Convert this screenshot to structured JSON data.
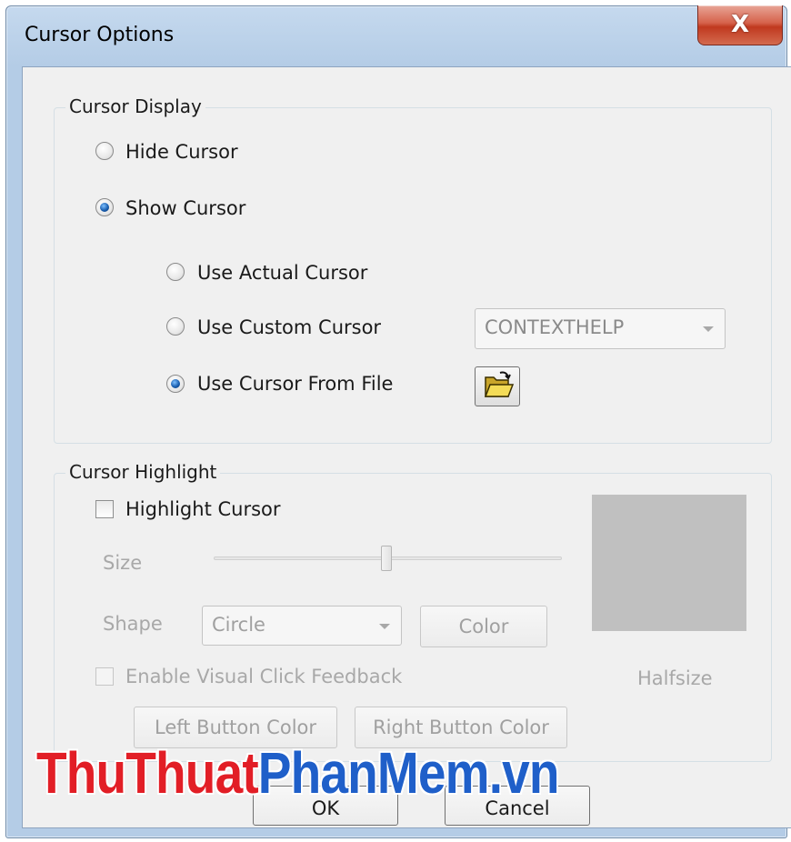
{
  "window": {
    "title": "Cursor Options",
    "close_glyph": "X"
  },
  "cursor_display": {
    "group_title": "Cursor Display",
    "hide_cursor": {
      "label": "Hide Cursor",
      "checked": false
    },
    "show_cursor": {
      "label": "Show Cursor",
      "checked": true
    },
    "use_actual_cursor": {
      "label": "Use Actual Cursor",
      "checked": false
    },
    "use_custom_cursor": {
      "label": "Use Custom Cursor",
      "checked": false
    },
    "custom_cursor_select": {
      "value": "CONTEXTHELP"
    },
    "use_cursor_from_file": {
      "label": "Use Cursor From File",
      "checked": true
    },
    "browse_icon": "open-folder-icon"
  },
  "cursor_highlight": {
    "group_title": "Cursor Highlight",
    "highlight_cursor": {
      "label": "Highlight Cursor",
      "checked": false
    },
    "size_label": "Size",
    "size_slider_value": 0.5,
    "shape_label": "Shape",
    "shape_select": {
      "value": "Circle"
    },
    "color_button": "Color",
    "enable_visual_click": {
      "label": "Enable Visual Click Feedback",
      "checked": false
    },
    "preview_caption": "Halfsize",
    "left_button_color": "Left Button Color",
    "right_button_color": "Right Button Color"
  },
  "footer": {
    "ok_button": "OK",
    "cancel_button": "Cancel"
  },
  "watermark": {
    "part1": "ThuThuat",
    "part2": "PhanMem.vn"
  },
  "colors": {
    "accent_radio": "#1a5fb0",
    "close_button": "#c0391f",
    "watermark_red": "#e21e26",
    "watermark_blue": "#1f5fc9",
    "preview_swatch": "#c0c0c0"
  }
}
